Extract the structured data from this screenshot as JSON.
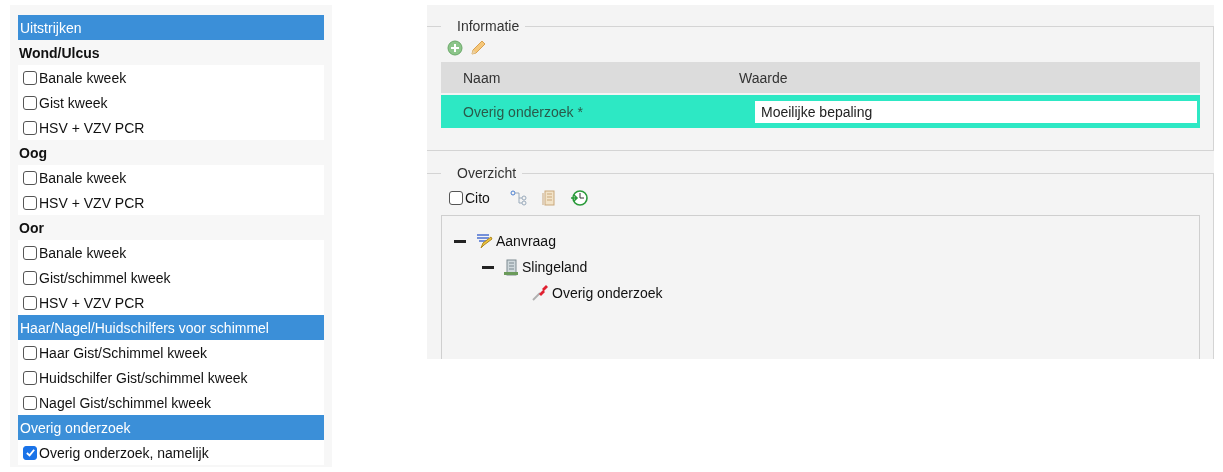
{
  "order_form": {
    "items": [
      {
        "kind": "header",
        "label": "Uitstrijken"
      },
      {
        "kind": "subheading",
        "label": "Wond/Ulcus"
      },
      {
        "kind": "checkbox",
        "label": "Banale kweek",
        "checked": false
      },
      {
        "kind": "checkbox",
        "label": "Gist kweek",
        "checked": false
      },
      {
        "kind": "checkbox",
        "label": "HSV + VZV PCR",
        "checked": false
      },
      {
        "kind": "subheading",
        "label": "Oog"
      },
      {
        "kind": "checkbox",
        "label": "Banale kweek",
        "checked": false
      },
      {
        "kind": "checkbox",
        "label": "HSV + VZV PCR",
        "checked": false
      },
      {
        "kind": "subheading",
        "label": "Oor"
      },
      {
        "kind": "checkbox",
        "label": "Banale kweek",
        "checked": false
      },
      {
        "kind": "checkbox",
        "label": "Gist/schimmel kweek",
        "checked": false
      },
      {
        "kind": "checkbox",
        "label": "HSV + VZV PCR",
        "checked": false
      },
      {
        "kind": "header",
        "label": "Haar/Nagel/Huidschilfers voor schimmel"
      },
      {
        "kind": "checkbox",
        "label": "Haar Gist/Schimmel kweek",
        "checked": false
      },
      {
        "kind": "checkbox",
        "label": "Huidschilfer Gist/schimmel kweek",
        "checked": false
      },
      {
        "kind": "checkbox",
        "label": "Nagel Gist/schimmel kweek",
        "checked": false
      },
      {
        "kind": "header",
        "label": "Overig onderzoek"
      },
      {
        "kind": "checkbox",
        "label": "Overig onderzoek, namelijk",
        "checked": true
      }
    ]
  },
  "information": {
    "legend": "Informatie",
    "columns": [
      "Naam",
      "Waarde"
    ],
    "rows": [
      {
        "name": "Overig onderzoek *",
        "value": "Moeilijke bepaling",
        "selected": true
      }
    ]
  },
  "overview": {
    "legend": "Overzicht",
    "cito": {
      "label": "Cito",
      "checked": false
    },
    "tree": [
      {
        "kind": "request",
        "label": "Aanvraag",
        "expanded": true,
        "children": [
          {
            "kind": "location",
            "label": "Slingeland",
            "expanded": true,
            "children": [
              {
                "kind": "sample",
                "label": "Overig onderzoek"
              }
            ]
          }
        ]
      }
    ]
  }
}
